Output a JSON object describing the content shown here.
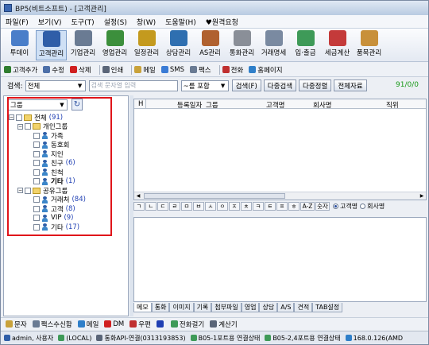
{
  "window": {
    "title": "BP5(비트소프트) - [고객관리]"
  },
  "menu": [
    "파일(F)",
    "보기(V)",
    "도구(T)",
    "설정(S)",
    "창(W)",
    "도움말(H)",
    "♥원격요청"
  ],
  "toolbar": [
    {
      "label": "투데이",
      "icon": "today-icon",
      "color": "#4a7ec9"
    },
    {
      "label": "고객관리",
      "icon": "customer-icon",
      "color": "#2f5ea8",
      "active": true
    },
    {
      "label": "기업관리",
      "icon": "company-icon",
      "color": "#6a7b93"
    },
    {
      "label": "영업관리",
      "icon": "sales-icon",
      "color": "#3c8f3c"
    },
    {
      "label": "일정관리",
      "icon": "schedule-icon",
      "color": "#c49a1e"
    },
    {
      "label": "상담관리",
      "icon": "consult-icon",
      "color": "#2f6fb0"
    },
    {
      "label": "AS관리",
      "icon": "as-icon",
      "color": "#b0612f"
    },
    {
      "label": "통화관리",
      "icon": "call-icon",
      "color": "#8a8f98"
    },
    {
      "label": "거래명세",
      "icon": "invoice-icon",
      "color": "#7a8aa1"
    },
    {
      "label": "입·출금",
      "icon": "cash-icon",
      "color": "#3e9a58"
    },
    {
      "label": "세금계산",
      "icon": "tax-icon",
      "color": "#c43a3a"
    },
    {
      "label": "품목관리",
      "icon": "product-icon",
      "color": "#c8903a"
    }
  ],
  "actions": [
    {
      "label": "고객추가",
      "icon": "add-customer-icon",
      "color": "#2f7d2f"
    },
    {
      "label": "수정",
      "icon": "edit-icon",
      "color": "#4d6fa8"
    },
    {
      "label": "삭제",
      "icon": "delete-icon",
      "color": "#d02020"
    },
    {
      "label": "인쇄",
      "icon": "print-icon",
      "color": "#5a6578"
    },
    {
      "label": "메일",
      "icon": "mail-icon",
      "color": "#c9a23a"
    },
    {
      "label": "SMS",
      "icon": "sms-icon",
      "color": "#3a7bd5"
    },
    {
      "label": "팩스",
      "icon": "fax-icon",
      "color": "#6a7b93"
    },
    {
      "label": "전화",
      "icon": "phone-icon",
      "color": "#c03030"
    },
    {
      "label": "홈페이지",
      "icon": "homepage-icon",
      "color": "#2f7fc9"
    }
  ],
  "search": {
    "label": "검색:",
    "scope": "전체",
    "placeholder": "검색 문자열 입력",
    "match": "~를 포함",
    "btn_search": "검색(F)",
    "btn_multi": "다중검색",
    "btn_sort": "다중정렬",
    "btn_all": "전체자료",
    "count": "91/0/0"
  },
  "tree": {
    "combo": "그룹",
    "nodes": [
      {
        "label": "전체",
        "count": "(91)",
        "kind": "folder",
        "sign": "-"
      },
      {
        "label": "개인그룹",
        "count": "",
        "kind": "folder",
        "sign": "-"
      },
      {
        "label": "가족",
        "count": "",
        "kind": "person"
      },
      {
        "label": "동호회",
        "count": "",
        "kind": "person"
      },
      {
        "label": "지인",
        "count": "",
        "kind": "person"
      },
      {
        "label": "친구",
        "count": "(6)",
        "kind": "person"
      },
      {
        "label": "친척",
        "count": "",
        "kind": "person"
      },
      {
        "label": "기타",
        "count": "(1)",
        "kind": "person",
        "bold": true
      },
      {
        "label": "공유그룹",
        "count": "",
        "kind": "folder",
        "sign": "-"
      },
      {
        "label": "거래처",
        "count": "(84)",
        "kind": "person"
      },
      {
        "label": "고객",
        "count": "(8)",
        "kind": "person"
      },
      {
        "label": "VIP",
        "count": "(9)",
        "kind": "person"
      },
      {
        "label": "기타",
        "count": "(17)",
        "kind": "person"
      }
    ]
  },
  "grid": {
    "columns": [
      "H",
      "등록일자",
      "그룹",
      "고객명",
      "회사명",
      "직위"
    ]
  },
  "consonants": [
    "ㄱ",
    "ㄴ",
    "ㄷ",
    "ㄹ",
    "ㅁ",
    "ㅂ",
    "ㅅ",
    "ㅇ",
    "ㅈ",
    "ㅊ",
    "ㅋ",
    "ㅌ",
    "ㅍ",
    "ㅎ",
    "A-Z",
    "숫자"
  ],
  "radios": {
    "opt1": "고객명",
    "opt2": "회사명"
  },
  "tabs": [
    "메모",
    "통화",
    "이미지",
    "기록",
    "첨부파일",
    "영업",
    "상담",
    "A/S",
    "견적",
    "TAB설정"
  ],
  "bottom": [
    {
      "label": "문자",
      "icon": "sms-doc-icon",
      "color": "#c9a23a"
    },
    {
      "label": "팩스수신함",
      "icon": "fax-inbox-icon",
      "color": "#6a7b93"
    },
    {
      "label": "메일",
      "icon": "mail-icon",
      "color": "#2f7fc9"
    },
    {
      "label": "DM",
      "icon": "dm-icon",
      "color": "#d02020"
    },
    {
      "label": "우편",
      "icon": "post-icon",
      "color": "#c03030"
    },
    {
      "label": "",
      "icon": "label-icon",
      "color": "#1f3fb3"
    },
    {
      "label": "전화걸기",
      "icon": "dial-icon",
      "color": "#3e9a58"
    },
    {
      "label": "계산기",
      "icon": "calculator-icon",
      "color": "#5a6578"
    }
  ],
  "status": [
    {
      "text": "admin, 사용자",
      "icon": "user-icon",
      "color": "#2f5ea8"
    },
    {
      "text": "(LOCAL)",
      "icon": "local-icon",
      "color": "#3e9a58"
    },
    {
      "text": "통화API-연결(0313193853)",
      "icon": "api-icon",
      "color": "#5a6578"
    },
    {
      "text": "B05-1포트용 연결상태",
      "icon": "port1-icon",
      "color": "#3e9a58"
    },
    {
      "text": "B05-2,4포트용 연결상태",
      "icon": "port2-icon",
      "color": "#3e9a58"
    },
    {
      "text": "168.0.126(AMD",
      "icon": "network-icon",
      "color": "#2f7fc9"
    }
  ]
}
